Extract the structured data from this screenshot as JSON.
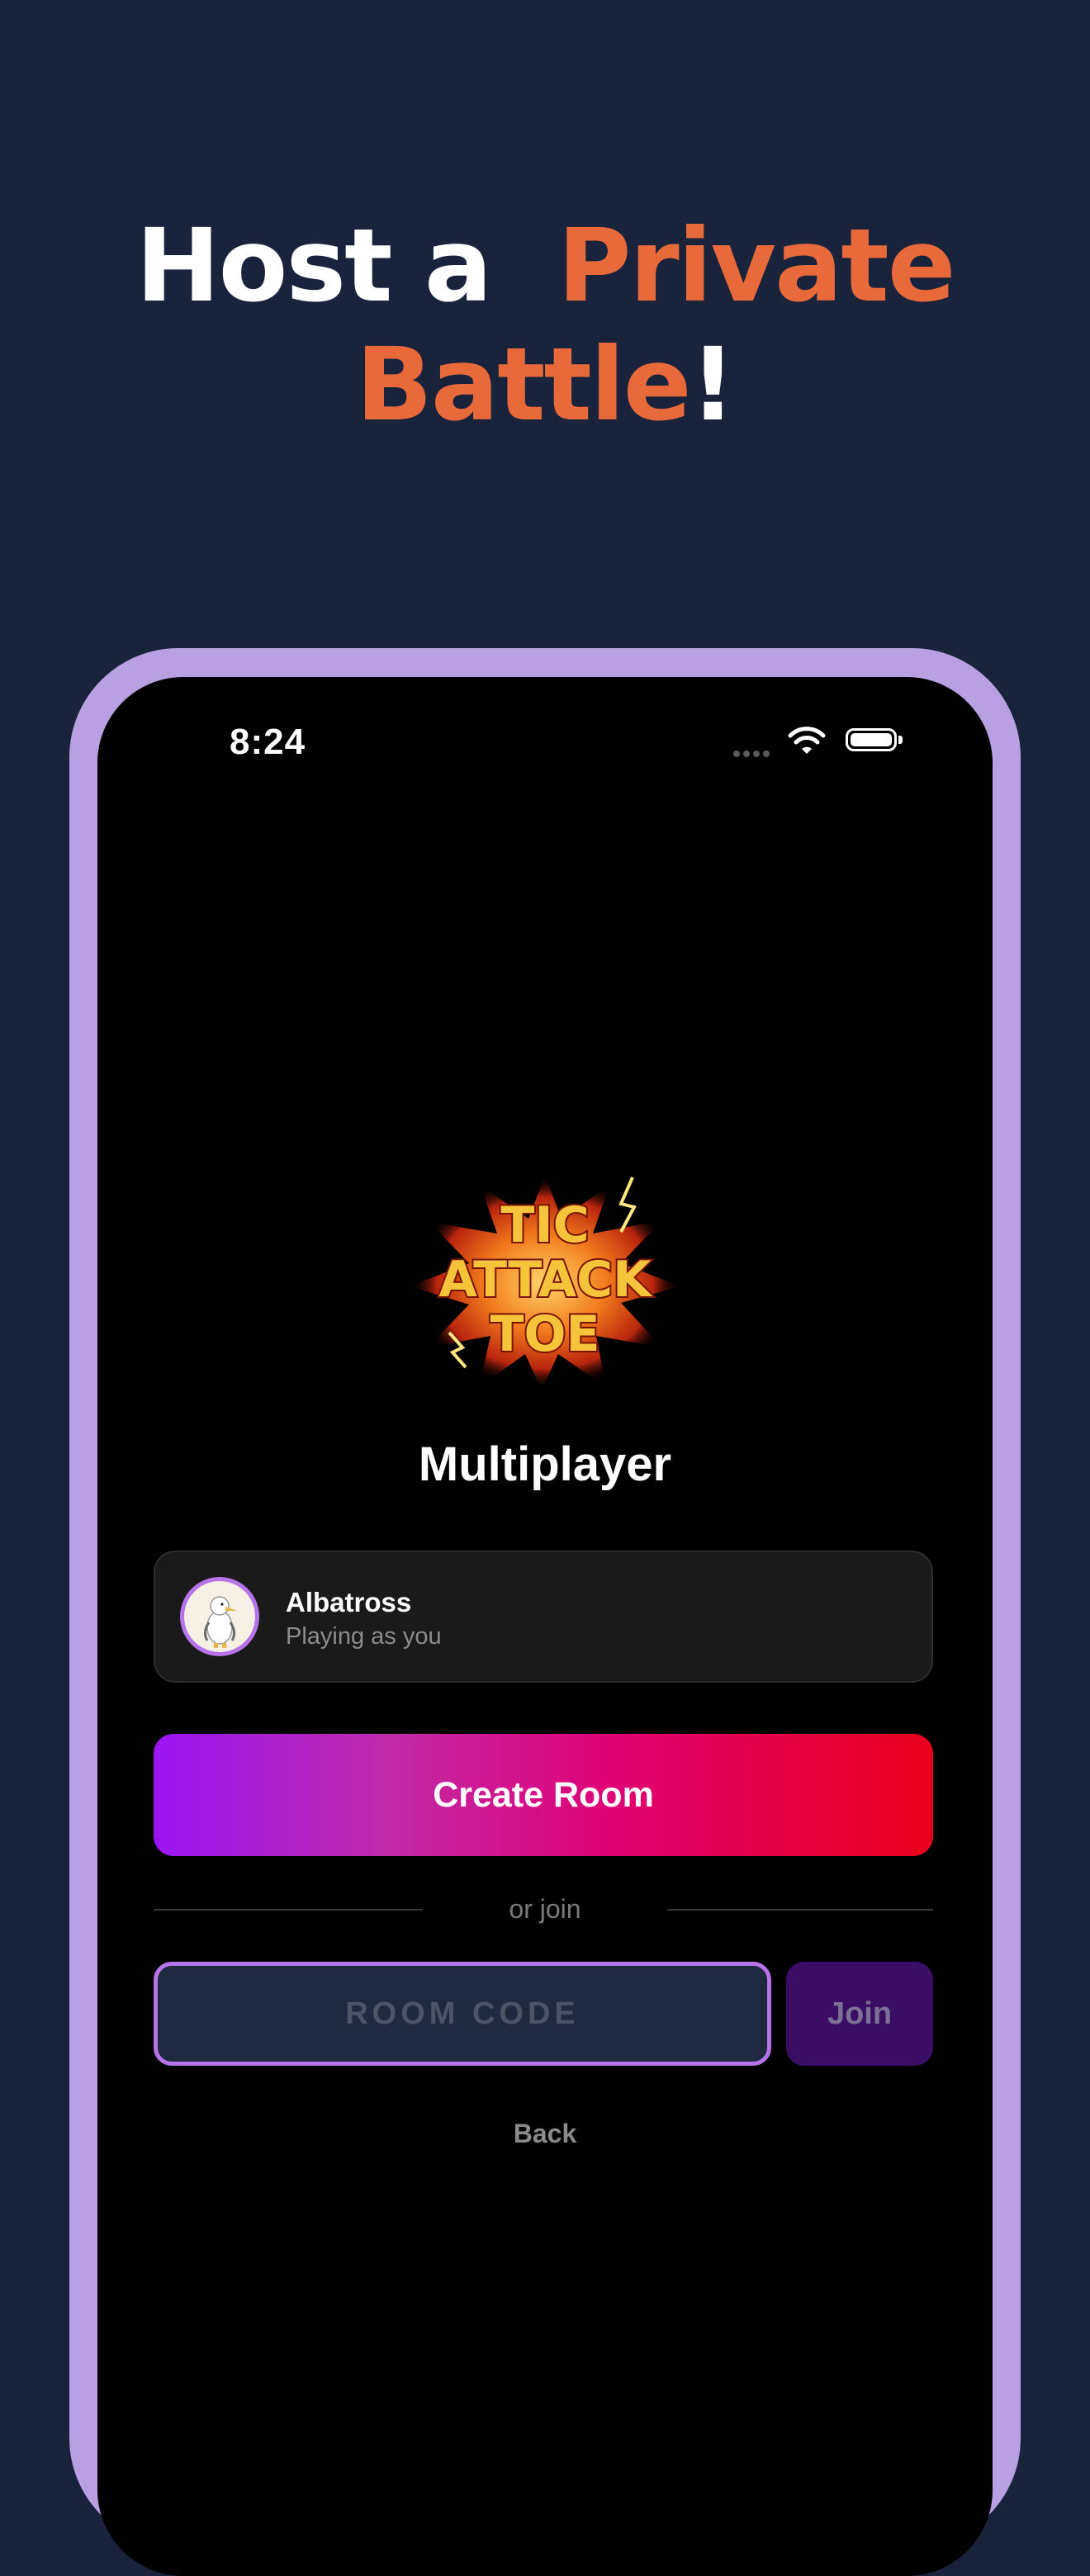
{
  "headline": {
    "part1": "Host a",
    "part2": "Private",
    "part3": "Battle",
    "part4": "!"
  },
  "colors": {
    "background": "#19233b",
    "accent_orange": "#e8693a",
    "frame": "#b8a0e2",
    "purple_outline": "#b673ea",
    "gradient_start": "#9a15f5",
    "gradient_end": "#e90019",
    "join_bg": "#3b0e66"
  },
  "status_bar": {
    "time": "8:24",
    "icons": [
      "cellular-dots-icon",
      "wifi-icon",
      "battery-icon"
    ]
  },
  "logo": {
    "line1": "TIC",
    "line2": "ATTACK",
    "line3": "TOE"
  },
  "screen": {
    "title": "Multiplayer",
    "player": {
      "name": "Albatross",
      "subtitle": "Playing as you",
      "avatar_icon": "albatross-avatar-icon"
    },
    "create_button": "Create Room",
    "divider_text": "or join",
    "room_code_placeholder": "ROOM CODE",
    "room_code_value": "",
    "join_button": "Join",
    "back_link": "Back"
  }
}
